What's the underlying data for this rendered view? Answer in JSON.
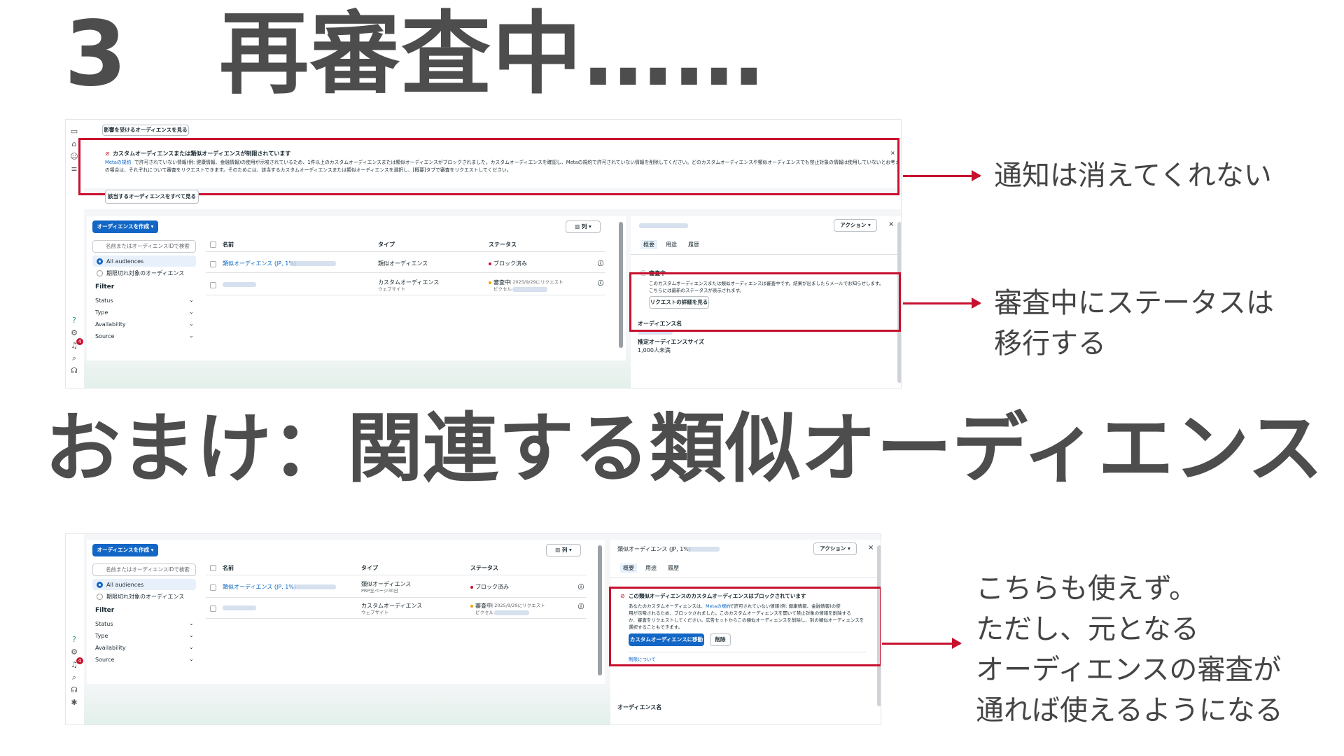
{
  "headings": {
    "h1": "3　再審査中……",
    "h2": "おまけ：関連する類似オーディエンス"
  },
  "notes": {
    "note1": "通知は消えてくれない",
    "note2": [
      "審査中にステータスは",
      "移行する"
    ],
    "note3": [
      "こちらも使えず。",
      "ただし、元となる",
      "オーディエンスの審査が",
      "通れば使えるようになる"
    ]
  },
  "shot1": {
    "affected_btn": "影響を受けるオーディエンスを見る",
    "alert_title": "カスタムオーディエンスまたは類似オーディエンスが制限されています",
    "alert_link": "Metaの規約",
    "alert_line1": "で許可されていない情報(例: 健康情報、金融情報)の使用が示唆されているため、1件以上のカスタムオーディエンスまたは類似オーディエンスがブロックされました。カスタムオーディエンスを確認し、Metaの規約で許可されていない情報を削除してください。どのカスタムオーディエンスや類似オーディエンスでも禁止対象の情報は使用していないとお考え",
    "alert_line2": "の場合は、それぞれについて審査をリクエストできます。そのためには、該当するカスタムオーディエンスまたは類似オーディエンスを選択し、[概要]タブで審査をリクエストしてください。",
    "see_all_btn": "該当するオーディエンスをすべて見る",
    "create_btn": "オーディエンスを作成",
    "columns_btn": "列",
    "search_placeholder": "名前またはオーディエンスIDで検索",
    "all_audiences": "All audiences",
    "expiring": "期限切れ対象のオーディエンス",
    "filter": "Filter",
    "filters": [
      "Status",
      "Type",
      "Availability",
      "Source"
    ],
    "col_name": "名前",
    "col_type": "タイプ",
    "col_status": "ステータス",
    "row1_name": "類似オーディエンス (JP, 1%)",
    "row1_type": "類似オーディエンス",
    "row1_status": "ブロック済み",
    "row2_type": "カスタムオーディエンス",
    "row2_type_sub": "ウェブサイト",
    "row2_status": "審査中",
    "row2_status_rest": "| 2025/9/29にリクエスト",
    "row2_status_sub": "ピクセル",
    "action_btn": "アクション",
    "tabs": [
      "概要",
      "用途",
      "履歴"
    ],
    "review_title": "審査中",
    "review_line1": "このカスタムオーディエンスまたは類似オーディエンスは審査中です。結果が出ましたらメールでお知らせします。",
    "review_line2": "こちらには最新のステータスが表示されます。",
    "request_btn": "リクエストの詳細を見る",
    "aud_name_label": "オーディエンス名",
    "size_label": "推定オーディエンスサイズ",
    "size_value": "1,000人未満",
    "rail_badge": "4"
  },
  "shot2": {
    "create_btn": "オーディエンスを作成",
    "columns_btn": "列",
    "search_placeholder": "名前またはオーディエンスIDで検索",
    "all_audiences": "All audiences",
    "expiring": "期限切れ対象のオーディエンス",
    "filter": "Filter",
    "filters": [
      "Status",
      "Type",
      "Availability",
      "Source"
    ],
    "col_name": "名前",
    "col_type": "タイプ",
    "col_status": "ステータス",
    "row1_name": "類似オーディエンス (JP, 1%) -",
    "row1_type": "類似オーディエンス",
    "row1_type_sub": "PRP全ページ30日",
    "row1_status": "ブロック済み",
    "row2_type": "カスタムオーディエンス",
    "row2_type_sub": "ウェブサイト",
    "row2_status": "審査中",
    "row2_status_rest": "| 2025/9/29にリクエスト",
    "row2_status_sub": "ピクセル",
    "panel_title": "類似オーディエンス (JP, 1%)",
    "action_btn": "アクション",
    "tabs": [
      "概要",
      "用途",
      "履歴"
    ],
    "blocked_title": "この類似オーディエンスのカスタムオーディエンスはブロックされています",
    "blocked_line1_a": "あなたのカスタムオーディエンスは、",
    "blocked_link": "Metaの規約",
    "blocked_line1_b": "で許可されていない情報(例: 健康情報、金融情報)の使",
    "blocked_line2": "用が示唆されるため、ブロックされました。このカスタムオーディエンスを開いて禁止対象の情報を削除する",
    "blocked_line3": "か、審査をリクエストしてください。広告セットからこの類似オーディエンスを削除し、別の類似オーディエンスを",
    "blocked_line4": "選択することもできます。",
    "goto_btn": "カスタムオーディエンスに移動",
    "delete_btn": "削除",
    "restrict_link": "制限について",
    "aud_name_label": "オーディエンス名",
    "rail_badge": "4"
  },
  "colors": {
    "accent_red": "#c8102e",
    "meta_blue": "#1266c5",
    "heading_gray": "#4d4d4d"
  }
}
